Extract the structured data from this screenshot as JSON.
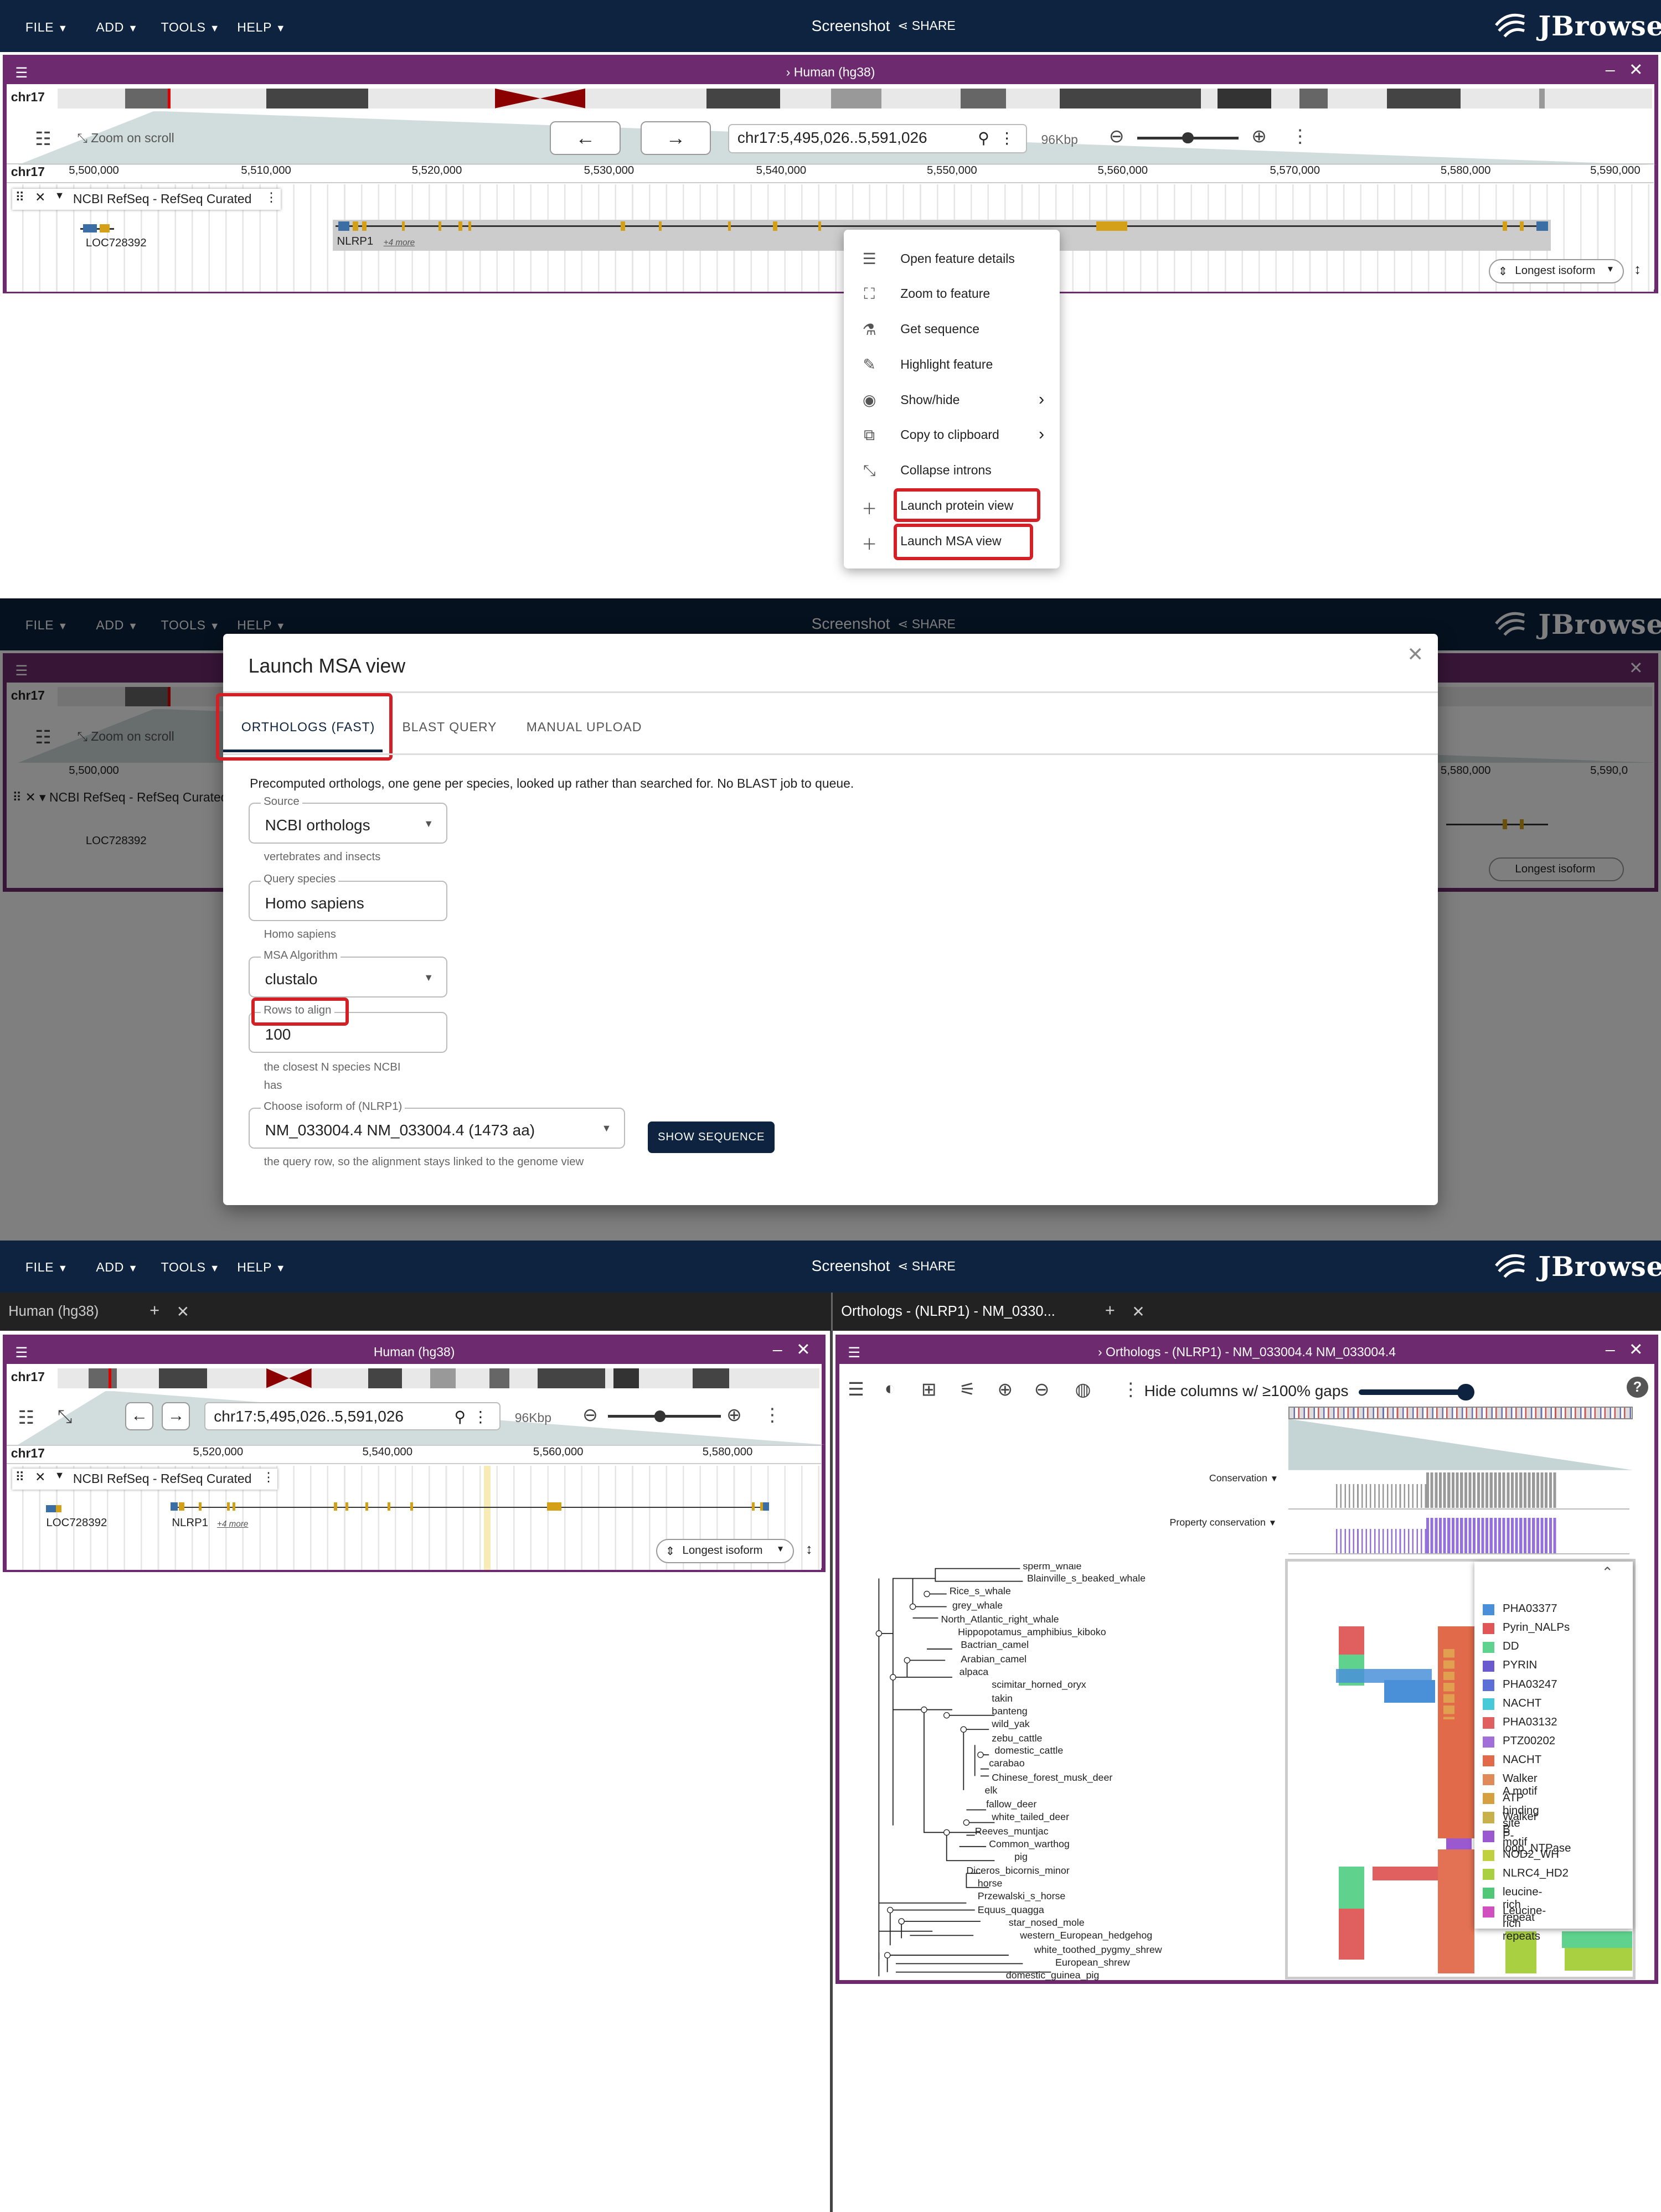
{
  "app": {
    "menus": [
      "FILE",
      "ADD",
      "TOOLS",
      "HELP"
    ],
    "session_title": "Screenshot",
    "share_label": "SHARE",
    "logo_text": "JBrowse",
    "brand_color": "#0d233f",
    "view_color": "#6e2a6e"
  },
  "panel1": {
    "view_title": "Human (hg38)",
    "chr": "chr17",
    "zoom_on_scroll": "Zoom on scroll",
    "locstring": "chr17:5,495,026..5,591,026",
    "span": "96Kbp",
    "ruler": [
      "5,500,000",
      "5,510,000",
      "5,520,000",
      "5,530,000",
      "5,540,000",
      "5,550,000",
      "5,560,000",
      "5,570,000",
      "5,580,000",
      "5,590,000"
    ],
    "track_name": "NCBI RefSeq - RefSeq Curated",
    "gene1": "LOC728392",
    "gene2": "NLRP1",
    "more": "+4 more",
    "isoform_btn": "Longest isoform",
    "context_menu": [
      {
        "icon": "list-icon",
        "label": "Open feature details"
      },
      {
        "icon": "zoom-icon",
        "label": "Zoom to feature"
      },
      {
        "icon": "microscope-icon",
        "label": "Get sequence"
      },
      {
        "icon": "highlight-icon",
        "label": "Highlight feature"
      },
      {
        "icon": "eye-icon",
        "label": "Show/hide"
      },
      {
        "icon": "copy-icon",
        "label": "Copy to clipboard"
      },
      {
        "icon": "collapse-icon",
        "label": "Collapse introns"
      },
      {
        "icon": "plus-icon",
        "label": "Launch protein view"
      },
      {
        "icon": "plus-icon",
        "label": "Launch MSA view"
      }
    ]
  },
  "panel2": {
    "dialog_title": "Launch MSA view",
    "tabs": [
      "ORTHOLOGS (FAST)",
      "BLAST QUERY",
      "MANUAL UPLOAD"
    ],
    "intro": "Precomputed orthologs, one gene per species, looked up rather than searched for. No BLAST job to queue.",
    "source_label": "Source",
    "source_value": "NCBI orthologs",
    "source_help": "vertebrates and insects",
    "query_label": "Query species",
    "query_value": "Homo sapiens",
    "query_help": "Homo sapiens",
    "algo_label": "MSA Algorithm",
    "algo_value": "clustalo",
    "rows_label": "Rows to align",
    "rows_value": "100",
    "rows_help_1": "the closest N species NCBI",
    "rows_help_2": "has",
    "iso_label": "Choose isoform of (NLRP1)",
    "iso_value": "NM_033004.4 NM_033004.4 (1473 aa)",
    "iso_help": "the query row, so the alignment stays linked to the genome view",
    "show_seq": "SHOW SEQUENCE",
    "bg_ruler_left": "5,500,000",
    "bg_ruler_right": [
      "5,580,000",
      "5,590,0"
    ]
  },
  "panel3": {
    "tab_left": "Human (hg38)",
    "tab_right": "Orthologs - (NLRP1) - NM_0330...",
    "msa_title": "Orthologs - (NLRP1) - NM_033004.4 NM_033004.4",
    "hide_cols": "Hide columns w/ ≥100% gaps",
    "conservation": "Conservation",
    "property_conservation": "Property conservation",
    "ruler": [
      "5,520,000",
      "5,540,000",
      "5,560,000",
      "5,580,000"
    ],
    "species": [
      "sperm_whale",
      "Blainville_s_beaked_whale",
      "Rice_s_whale",
      "grey_whale",
      "North_Atlantic_right_whale",
      "Hippopotamus_amphibius_kiboko",
      "Bactrian_camel",
      "Arabian_camel",
      "alpaca",
      "scimitar_horned_oryx",
      "takin",
      "banteng",
      "wild_yak",
      "zebu_cattle",
      "domestic_cattle",
      "carabao",
      "Chinese_forest_musk_deer",
      "elk",
      "fallow_deer",
      "white_tailed_deer",
      "Reeves_muntjac",
      "Common_warthog",
      "pig",
      "Diceros_bicornis_minor",
      "horse",
      "Przewalski_s_horse",
      "Equus_quagga",
      "star_nosed_mole",
      "western_European_hedgehog",
      "white_toothed_pygmy_shrew",
      "European_shrew",
      "domestic_guinea_pig"
    ],
    "legend": [
      {
        "name": "PHA03377",
        "color": "#4a90d9"
      },
      {
        "name": "Pyrin_NALPs",
        "color": "#e05555"
      },
      {
        "name": "DD",
        "color": "#5fd38d"
      },
      {
        "name": "PYRIN",
        "color": "#6a5acd"
      },
      {
        "name": "PHA03247",
        "color": "#5b6fd6"
      },
      {
        "name": "NACHT",
        "color": "#48c9d8"
      },
      {
        "name": "PHA03132",
        "color": "#e06060"
      },
      {
        "name": "PTZ00202",
        "color": "#a070d8"
      },
      {
        "name": "NACHT",
        "color": "#e06a4a"
      },
      {
        "name": "Walker A motif",
        "color": "#e08a5a"
      },
      {
        "name": "ATP binding site",
        "color": "#d4a040"
      },
      {
        "name": "Walker B motif",
        "color": "#c8b04a"
      },
      {
        "name": "P-loop_NTPase",
        "color": "#9b59d0"
      },
      {
        "name": "NOD2_WH",
        "color": "#c0d040"
      },
      {
        "name": "NLRC4_HD2",
        "color": "#a8d040"
      },
      {
        "name": "leucine-rich repeat",
        "color": "#50c878"
      },
      {
        "name": "Leucine-rich repeats",
        "color": "#d050c0"
      }
    ]
  }
}
